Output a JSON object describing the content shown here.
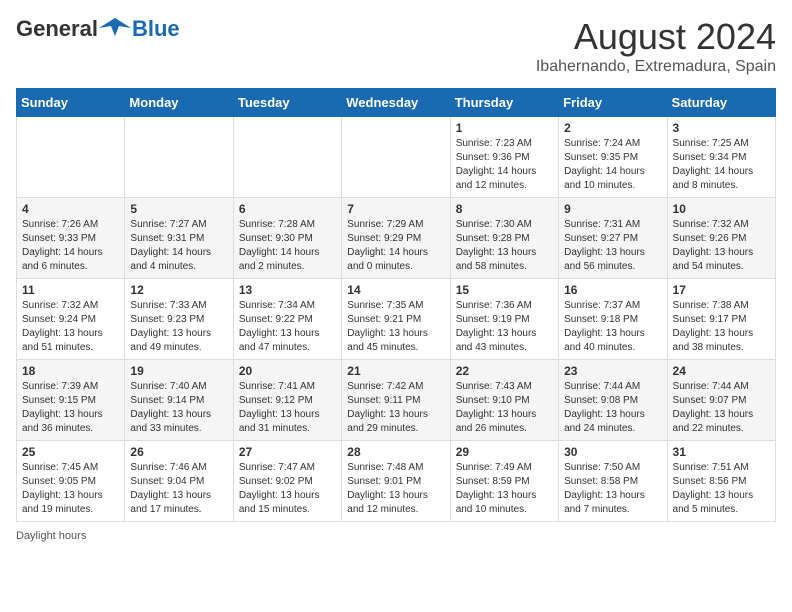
{
  "header": {
    "logo_general": "General",
    "logo_blue": "Blue",
    "main_title": "August 2024",
    "subtitle": "Ibahernando, Extremadura, Spain"
  },
  "weekdays": [
    "Sunday",
    "Monday",
    "Tuesday",
    "Wednesday",
    "Thursday",
    "Friday",
    "Saturday"
  ],
  "footer": {
    "daylight_hours": "Daylight hours"
  },
  "weeks": [
    [
      {
        "day": "",
        "info": ""
      },
      {
        "day": "",
        "info": ""
      },
      {
        "day": "",
        "info": ""
      },
      {
        "day": "",
        "info": ""
      },
      {
        "day": "1",
        "info": "Sunrise: 7:23 AM\nSunset: 9:36 PM\nDaylight: 14 hours and 12 minutes."
      },
      {
        "day": "2",
        "info": "Sunrise: 7:24 AM\nSunset: 9:35 PM\nDaylight: 14 hours and 10 minutes."
      },
      {
        "day": "3",
        "info": "Sunrise: 7:25 AM\nSunset: 9:34 PM\nDaylight: 14 hours and 8 minutes."
      }
    ],
    [
      {
        "day": "4",
        "info": "Sunrise: 7:26 AM\nSunset: 9:33 PM\nDaylight: 14 hours and 6 minutes."
      },
      {
        "day": "5",
        "info": "Sunrise: 7:27 AM\nSunset: 9:31 PM\nDaylight: 14 hours and 4 minutes."
      },
      {
        "day": "6",
        "info": "Sunrise: 7:28 AM\nSunset: 9:30 PM\nDaylight: 14 hours and 2 minutes."
      },
      {
        "day": "7",
        "info": "Sunrise: 7:29 AM\nSunset: 9:29 PM\nDaylight: 14 hours and 0 minutes."
      },
      {
        "day": "8",
        "info": "Sunrise: 7:30 AM\nSunset: 9:28 PM\nDaylight: 13 hours and 58 minutes."
      },
      {
        "day": "9",
        "info": "Sunrise: 7:31 AM\nSunset: 9:27 PM\nDaylight: 13 hours and 56 minutes."
      },
      {
        "day": "10",
        "info": "Sunrise: 7:32 AM\nSunset: 9:26 PM\nDaylight: 13 hours and 54 minutes."
      }
    ],
    [
      {
        "day": "11",
        "info": "Sunrise: 7:32 AM\nSunset: 9:24 PM\nDaylight: 13 hours and 51 minutes."
      },
      {
        "day": "12",
        "info": "Sunrise: 7:33 AM\nSunset: 9:23 PM\nDaylight: 13 hours and 49 minutes."
      },
      {
        "day": "13",
        "info": "Sunrise: 7:34 AM\nSunset: 9:22 PM\nDaylight: 13 hours and 47 minutes."
      },
      {
        "day": "14",
        "info": "Sunrise: 7:35 AM\nSunset: 9:21 PM\nDaylight: 13 hours and 45 minutes."
      },
      {
        "day": "15",
        "info": "Sunrise: 7:36 AM\nSunset: 9:19 PM\nDaylight: 13 hours and 43 minutes."
      },
      {
        "day": "16",
        "info": "Sunrise: 7:37 AM\nSunset: 9:18 PM\nDaylight: 13 hours and 40 minutes."
      },
      {
        "day": "17",
        "info": "Sunrise: 7:38 AM\nSunset: 9:17 PM\nDaylight: 13 hours and 38 minutes."
      }
    ],
    [
      {
        "day": "18",
        "info": "Sunrise: 7:39 AM\nSunset: 9:15 PM\nDaylight: 13 hours and 36 minutes."
      },
      {
        "day": "19",
        "info": "Sunrise: 7:40 AM\nSunset: 9:14 PM\nDaylight: 13 hours and 33 minutes."
      },
      {
        "day": "20",
        "info": "Sunrise: 7:41 AM\nSunset: 9:12 PM\nDaylight: 13 hours and 31 minutes."
      },
      {
        "day": "21",
        "info": "Sunrise: 7:42 AM\nSunset: 9:11 PM\nDaylight: 13 hours and 29 minutes."
      },
      {
        "day": "22",
        "info": "Sunrise: 7:43 AM\nSunset: 9:10 PM\nDaylight: 13 hours and 26 minutes."
      },
      {
        "day": "23",
        "info": "Sunrise: 7:44 AM\nSunset: 9:08 PM\nDaylight: 13 hours and 24 minutes."
      },
      {
        "day": "24",
        "info": "Sunrise: 7:44 AM\nSunset: 9:07 PM\nDaylight: 13 hours and 22 minutes."
      }
    ],
    [
      {
        "day": "25",
        "info": "Sunrise: 7:45 AM\nSunset: 9:05 PM\nDaylight: 13 hours and 19 minutes."
      },
      {
        "day": "26",
        "info": "Sunrise: 7:46 AM\nSunset: 9:04 PM\nDaylight: 13 hours and 17 minutes."
      },
      {
        "day": "27",
        "info": "Sunrise: 7:47 AM\nSunset: 9:02 PM\nDaylight: 13 hours and 15 minutes."
      },
      {
        "day": "28",
        "info": "Sunrise: 7:48 AM\nSunset: 9:01 PM\nDaylight: 13 hours and 12 minutes."
      },
      {
        "day": "29",
        "info": "Sunrise: 7:49 AM\nSunset: 8:59 PM\nDaylight: 13 hours and 10 minutes."
      },
      {
        "day": "30",
        "info": "Sunrise: 7:50 AM\nSunset: 8:58 PM\nDaylight: 13 hours and 7 minutes."
      },
      {
        "day": "31",
        "info": "Sunrise: 7:51 AM\nSunset: 8:56 PM\nDaylight: 13 hours and 5 minutes."
      }
    ]
  ]
}
